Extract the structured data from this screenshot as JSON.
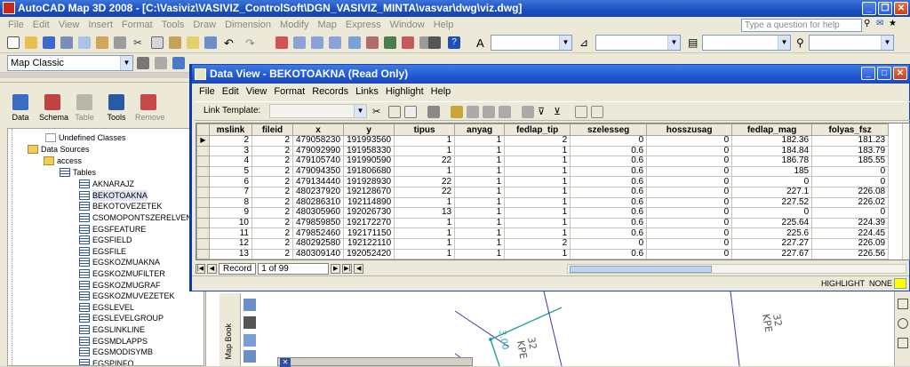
{
  "app": {
    "title": "AutoCAD Map 3D 2008 - [C:\\Vasiviz\\VASIVIZ_ControlSoft\\DGN_VASIVIZ_MINTA\\vasvar\\dwg\\viz.dwg]",
    "help_placeholder": "Type a question for help"
  },
  "menu": [
    "File",
    "Edit",
    "View",
    "Insert",
    "Format",
    "Tools",
    "Draw",
    "Dimension",
    "Modify",
    "Map",
    "Express",
    "Window",
    "Help"
  ],
  "workspace": {
    "value": "Map Classic"
  },
  "toolbar_values": {
    "top_right_1": "",
    "top_right_2": "",
    "top_right_3": "",
    "top_right_4": ""
  },
  "task_tools": [
    {
      "label": "Data",
      "icon": "data-icon",
      "color": "#3b6cc4"
    },
    {
      "label": "Schema",
      "icon": "schema-icon",
      "color": "#c24242"
    },
    {
      "label": "Table",
      "icon": "table-icon",
      "color": "#b9b6aa"
    },
    {
      "label": "Tools",
      "icon": "tools-icon",
      "color": "#2a5aa6"
    },
    {
      "label": "Remove",
      "icon": "remove-icon",
      "color": "#c64a4a"
    }
  ],
  "tree": {
    "undefined_classes": "Undefined Classes",
    "data_sources": "Data Sources",
    "access": "access",
    "tables": "Tables",
    "items": [
      "AKNARAJZ",
      "BEKOTOAKNA",
      "BEKOTOVEZETEK",
      "CSOMOPONTSZERELVENY",
      "EGSFEATURE",
      "EGSFIELD",
      "EGSFILE",
      "EGSKOZMUAKNA",
      "EGSKOZMUFILTER",
      "EGSKOZMUGRAF",
      "EGSKOZMUVEZETEK",
      "EGSLEVEL",
      "EGSLEVELGROUP",
      "EGSLINKLINE",
      "EGSMDLAPPS",
      "EGSMODISYMB",
      "EGSPINFO"
    ],
    "selected": "BEKOTOAKNA"
  },
  "mapbook_label": "Map Book",
  "data_view": {
    "title": "Data View - BEKOTOAKNA (Read Only)",
    "menu": [
      "File",
      "Edit",
      "View",
      "Format",
      "Records",
      "Links",
      "Highlight",
      "Help"
    ],
    "link_template_label": "Link Template:",
    "columns": [
      "mslink",
      "fileid",
      "x",
      "y",
      "tipus",
      "anyag",
      "fedlap_tip",
      "szelesseg",
      "hosszusag",
      "fedlap_mag",
      "folyas_fsz"
    ],
    "rows": [
      [
        "2",
        "2",
        "479058230",
        "191993560",
        "1",
        "1",
        "2",
        "0",
        "0",
        "182.36",
        "181.23"
      ],
      [
        "3",
        "2",
        "479092990",
        "191958330",
        "1",
        "1",
        "1",
        "0.6",
        "0",
        "184.84",
        "183.79"
      ],
      [
        "4",
        "2",
        "479105740",
        "191990590",
        "22",
        "1",
        "1",
        "0.6",
        "0",
        "186.78",
        "185.55"
      ],
      [
        "5",
        "2",
        "479094350",
        "191806680",
        "1",
        "1",
        "1",
        "0.6",
        "0",
        "185",
        "0"
      ],
      [
        "6",
        "2",
        "479134440",
        "191928930",
        "22",
        "1",
        "1",
        "0.6",
        "0",
        "0",
        "0"
      ],
      [
        "7",
        "2",
        "480237920",
        "192128670",
        "22",
        "1",
        "1",
        "0.6",
        "0",
        "227.1",
        "226.08"
      ],
      [
        "8",
        "2",
        "480286310",
        "192114890",
        "1",
        "1",
        "1",
        "0.6",
        "0",
        "227.52",
        "226.02"
      ],
      [
        "9",
        "2",
        "480305960",
        "192026730",
        "13",
        "1",
        "1",
        "0.6",
        "0",
        "0",
        "0"
      ],
      [
        "10",
        "2",
        "479859850",
        "192172270",
        "1",
        "1",
        "1",
        "0.6",
        "0",
        "225.64",
        "224.39"
      ],
      [
        "11",
        "2",
        "479852460",
        "192171150",
        "1",
        "1",
        "1",
        "0.6",
        "0",
        "225.6",
        "224.45"
      ],
      [
        "12",
        "2",
        "480292580",
        "192122110",
        "1",
        "1",
        "2",
        "0",
        "0",
        "227.27",
        "226.09"
      ],
      [
        "13",
        "2",
        "480309140",
        "192052420",
        "1",
        "1",
        "1",
        "0.6",
        "0",
        "227.67",
        "226.56"
      ]
    ],
    "record_label": "Record",
    "record_value": "1 of 99",
    "status_highlight": "HIGHLIGHT",
    "status_none": "NONE"
  },
  "drawing_labels": {
    "label_a": "3.00",
    "label_b": "32\nKPE",
    "label_c": "32\nKPE"
  }
}
